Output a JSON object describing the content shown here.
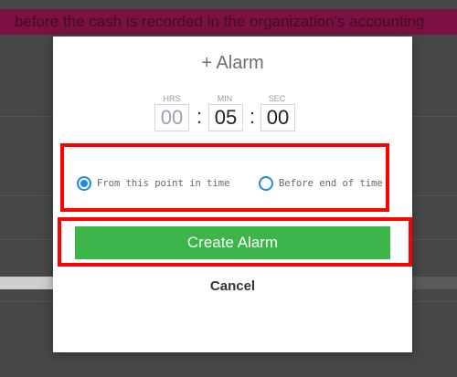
{
  "banner": {
    "text": "before the cash is recorded in the organization's accounting"
  },
  "alarm": {
    "title": "+ Alarm",
    "labels": {
      "hrs": "HRS",
      "min": "MIN",
      "sec": "SEC"
    },
    "values": {
      "hrs": "00",
      "min": "05",
      "sec": "00"
    },
    "separator": ":",
    "options": [
      {
        "label": "From this point in time",
        "checked": true
      },
      {
        "label": "Before end of time",
        "checked": false
      }
    ],
    "create_label": "Create Alarm",
    "cancel_label": "Cancel"
  },
  "colors": {
    "primary": "#3cb54a",
    "radio": "#1e88e5",
    "highlight": "#ff0000",
    "banner": "#7a1142"
  }
}
